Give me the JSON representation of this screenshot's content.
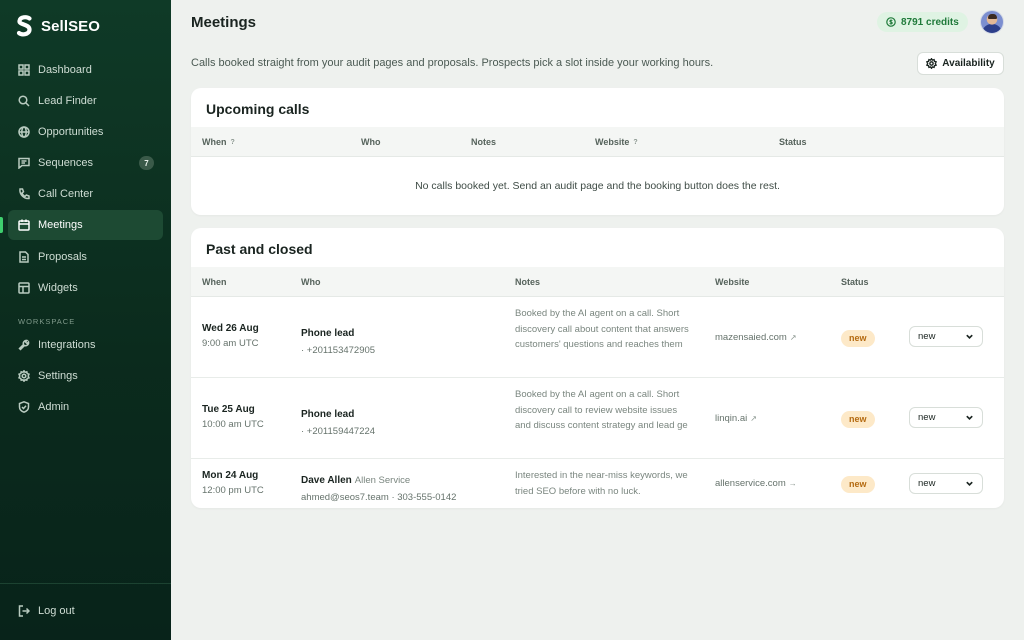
{
  "brand": {
    "name": "SellSEO",
    "accent": "#3ecf6e"
  },
  "sidebar": {
    "items": [
      {
        "label": "Dashboard",
        "icon": "dashboard-icon"
      },
      {
        "label": "Lead Finder",
        "icon": "search-icon"
      },
      {
        "label": "Opportunities",
        "icon": "globe-icon"
      },
      {
        "label": "Sequences",
        "icon": "message-icon",
        "badge": "7"
      },
      {
        "label": "Call Center",
        "icon": "phone-icon"
      },
      {
        "label": "Meetings",
        "icon": "calendar-icon",
        "active": true
      },
      {
        "label": "Proposals",
        "icon": "document-icon"
      },
      {
        "label": "Widgets",
        "icon": "widget-icon"
      }
    ],
    "section_label": "WORKSPACE",
    "workspace_items": [
      {
        "label": "Integrations",
        "icon": "wrench-icon"
      },
      {
        "label": "Settings",
        "icon": "gear-icon"
      },
      {
        "label": "Admin",
        "icon": "shield-icon"
      }
    ],
    "logout": {
      "label": "Log out",
      "icon": "logout-icon"
    }
  },
  "header": {
    "title": "Meetings",
    "credits": "8791 credits",
    "subtitle": "Calls booked straight from your audit pages and proposals. Prospects pick a slot inside your working hours.",
    "availability_label": "Availability"
  },
  "upcoming": {
    "title": "Upcoming calls",
    "columns": {
      "when": "When",
      "who": "Who",
      "notes": "Notes",
      "website": "Website",
      "status": "Status"
    },
    "help_mark": "?",
    "empty_text": "No calls booked yet. Send an audit page and the booking button does the rest."
  },
  "past": {
    "title": "Past and closed",
    "columns": {
      "when": "When",
      "who": "Who",
      "notes": "Notes",
      "website": "Website",
      "status": "Status"
    },
    "rows": [
      {
        "date": "Wed 26 Aug",
        "time": "9:00 am UTC",
        "who": "Phone lead",
        "company": "",
        "contact": "· +201153472905",
        "notes": "Booked by the AI agent on a call. Short discovery call about content that answers customers' questions and reaches them",
        "website": "mazensaied.com",
        "website_icon": "↗",
        "status": "new",
        "select": "new"
      },
      {
        "date": "Tue 25 Aug",
        "time": "10:00 am UTC",
        "who": "Phone lead",
        "company": "",
        "contact": "· +201159447224",
        "notes": "Booked by the AI agent on a call. Short discovery call to review website issues and discuss content strategy and lead ge",
        "website": "linqin.ai",
        "website_icon": "↗",
        "status": "new",
        "select": "new"
      },
      {
        "date": "Mon 24 Aug",
        "time": "12:00 pm UTC",
        "who": "Dave Allen",
        "company": "Allen Service",
        "contact": "ahmed@seos7.team · 303-555-0142",
        "notes": "Interested in the near-miss keywords, we tried SEO before with no luck.",
        "website": "allenservice.com",
        "website_icon": "→",
        "status": "new",
        "select": "new"
      }
    ]
  }
}
